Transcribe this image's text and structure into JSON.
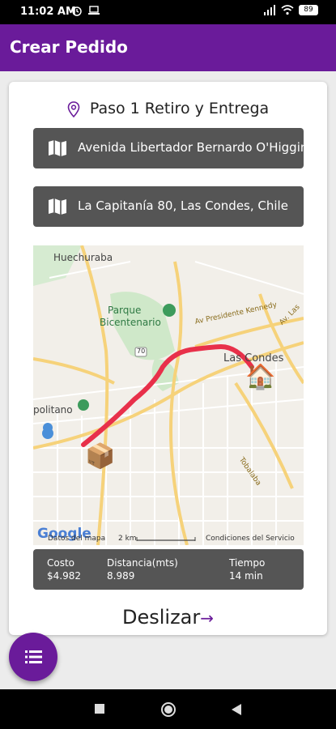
{
  "status_bar": {
    "time": "11:02 AM",
    "battery": "89"
  },
  "app_bar": {
    "title": "Crear Pedido"
  },
  "step": {
    "label": "Paso 1 Retiro y Entrega"
  },
  "pickup": {
    "address": "Avenida Libertador Bernardo O'Higgins"
  },
  "dropoff": {
    "address": "La Capitanía 80, Las Condes, Chile"
  },
  "map": {
    "labels": {
      "huechuraba": "Huechuraba",
      "parque": "Parque",
      "bicentenario": "Bicentenario",
      "kennedy": "Av Presidente Kennedy",
      "las_condes": "Las Condes",
      "av_las": "Av. Las",
      "politano": "politano",
      "tobalaba": "Tobalaba",
      "highway": "70",
      "google": "Google",
      "datos": "Datos del mapa",
      "scale": "2 km",
      "condiciones": "Condiciones del Servicio"
    }
  },
  "summary": {
    "cost_label": "Costo",
    "cost_value": "$4.982",
    "distance_label": "Distancia(mts)",
    "distance_value": "8.989",
    "time_label": "Tiempo",
    "time_value": "14 min"
  },
  "swipe": {
    "label": "Deslizar",
    "arrow": "→"
  },
  "colors": {
    "primary": "#6a1b9a",
    "route": "#e8304a",
    "panel": "#555555"
  },
  "icons": [
    "location-pin-icon",
    "map-icon",
    "package-icon",
    "house-icon",
    "menu-list-icon"
  ]
}
